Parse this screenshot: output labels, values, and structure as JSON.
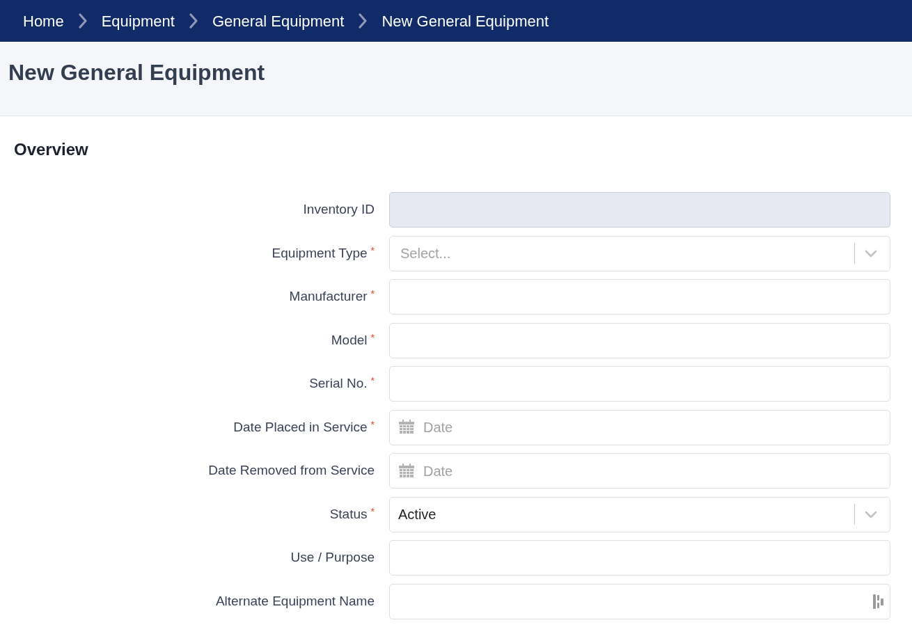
{
  "breadcrumb": [
    "Home",
    "Equipment",
    "General Equipment",
    "New General Equipment"
  ],
  "page_title": "New General Equipment",
  "section": {
    "title": "Overview",
    "fields": [
      {
        "label": "Inventory ID",
        "kind": "text",
        "disabled": true,
        "autofill": false
      },
      {
        "label": "Equipment Type",
        "required_mark": "*",
        "kind": "select",
        "placeholder": "Select...",
        "disabled": false,
        "autofill": false
      },
      {
        "label": "Manufacturer",
        "required_mark": "*",
        "kind": "text",
        "disabled": false,
        "autofill": false
      },
      {
        "label": "Model",
        "required_mark": "*",
        "kind": "text",
        "disabled": false,
        "autofill": false
      },
      {
        "label": "Serial No.",
        "required_mark": "*",
        "kind": "text",
        "disabled": false,
        "autofill": false
      },
      {
        "label": "Date Placed in Service",
        "required_mark": "*",
        "kind": "date",
        "placeholder": "Date",
        "disabled": false,
        "autofill": false
      },
      {
        "label": "Date Removed from Service",
        "kind": "date",
        "placeholder": "Date",
        "disabled": false,
        "autofill": false
      },
      {
        "label": "Status",
        "required_mark": "*",
        "kind": "select",
        "value": "Active",
        "disabled": false,
        "autofill": false
      },
      {
        "label": "Use / Purpose",
        "kind": "text",
        "disabled": false,
        "autofill": false
      },
      {
        "label": "Alternate Equipment Name",
        "kind": "text",
        "disabled": false,
        "autofill": true
      }
    ]
  }
}
